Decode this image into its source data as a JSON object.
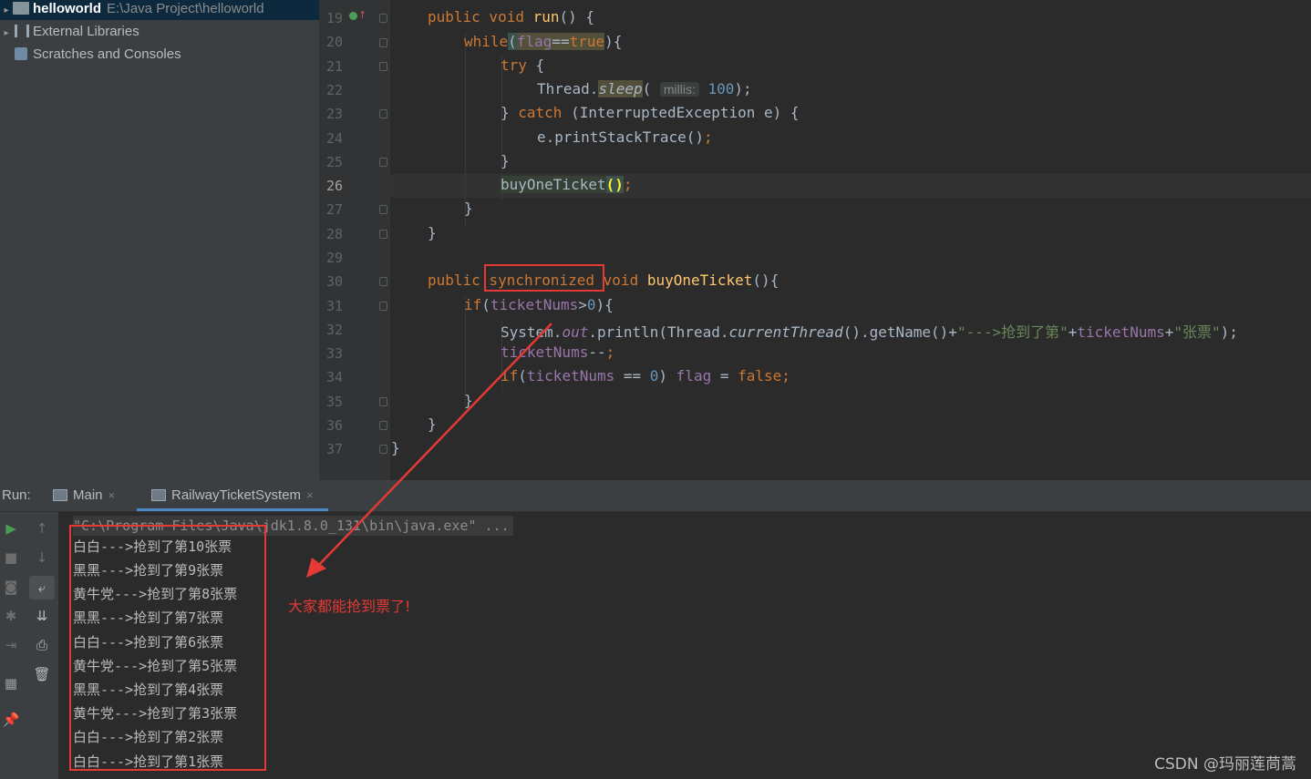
{
  "project_tree": {
    "items": [
      {
        "name": "helloworld",
        "path": "E:\\Java Project\\helloworld"
      },
      {
        "name": "External Libraries"
      },
      {
        "name": "Scratches and Consoles"
      }
    ]
  },
  "editor": {
    "line_numbers": [
      "19",
      "20",
      "21",
      "22",
      "23",
      "24",
      "25",
      "26",
      "27",
      "28",
      "29",
      "30",
      "31",
      "32",
      "33",
      "34",
      "35",
      "36",
      "37"
    ],
    "current_line": "26",
    "code": {
      "l19": {
        "kw": "public void ",
        "fn": "run",
        "rest": "() {"
      },
      "l20": {
        "kw": "while",
        "p1": "(",
        "flag": "flag",
        "op": "==",
        "tru": "true",
        "p2": "){"
      },
      "l21": {
        "kw": "try",
        "rest": " {"
      },
      "l22": {
        "cls": "Thread.",
        "method": "sleep",
        "p1": "( ",
        "hint": "millis:",
        "num": "100",
        "p2": ");"
      },
      "l23": {
        "b": "} ",
        "kw": "catch",
        "rest": " (InterruptedException e) {"
      },
      "l24": {
        "call": "e.printStackTrace()",
        "semi": ";"
      },
      "l25": {
        "rest": "}"
      },
      "l26": {
        "call": "buyOneTicket",
        "paren": "()",
        "semi": ";"
      },
      "l27": {
        "rest": "}"
      },
      "l28": {
        "rest": "}"
      },
      "l30": {
        "kw1": "public ",
        "sync": "synchronized",
        "kw2": " void ",
        "fn": "buyOneTicket",
        "rest": "(){"
      },
      "l31": {
        "kw": "if",
        "p1": "(",
        "fld": "ticketNums",
        "op": ">",
        "num": "0",
        "p2": "){"
      },
      "l32": {
        "a": "System.",
        "out": "out",
        "b": ".println(Thread.",
        "ct": "currentThread",
        "c": "().getName()+",
        "s1": "\"--->抢到了第\"",
        "d": "+",
        "fld": "ticketNums",
        "e": "+",
        "s2": "\"张票\"",
        "f": ");"
      },
      "l33": {
        "fld": "ticketNums",
        "op": "--",
        "semi": ";"
      },
      "l34": {
        "kw": "if",
        "p1": "(",
        "fld": "ticketNums",
        "op": " == ",
        "num": "0",
        "p2": ") ",
        "flag": "flag",
        "eq": " = ",
        "fls": "false",
        "semi": ";"
      },
      "l35": {
        "rest": "}"
      },
      "l36": {
        "rest": "}"
      },
      "l37": {
        "rest": "}"
      }
    }
  },
  "run_panel": {
    "label": "Run:",
    "tabs": [
      {
        "label": "Main",
        "close": "×"
      },
      {
        "label": "RailwayTicketSystem",
        "close": "×"
      }
    ],
    "command": "\"C:\\Program Files\\Java\\jdk1.8.0_131\\bin\\java.exe\" ...",
    "output": [
      "白白--->抢到了第10张票",
      "黑黑--->抢到了第9张票",
      "黄牛党--->抢到了第8张票",
      "黑黑--->抢到了第7张票",
      "白白--->抢到了第6张票",
      "黄牛党--->抢到了第5张票",
      "黑黑--->抢到了第4张票",
      "黄牛党--->抢到了第3张票",
      "白白--->抢到了第2张票",
      "白白--->抢到了第1张票"
    ]
  },
  "annotation": "大家都能抢到票了!",
  "watermark": "CSDN @玛丽莲茼蒿",
  "colors": {
    "annotation_red": "#e53935",
    "keyword": "#cc7832",
    "method_decl": "#ffc66d",
    "number": "#6897bb",
    "string": "#6a8759",
    "field": "#9876aa"
  }
}
